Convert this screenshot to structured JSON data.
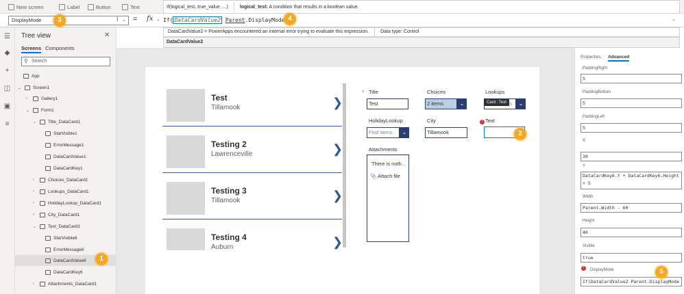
{
  "ribbon": {
    "new_screen": "New screen",
    "label": "Label",
    "button": "Button",
    "text": "Text"
  },
  "tooltip": {
    "signature": "If(logical_test, true_value, ...)",
    "param_name": "logical_test:",
    "param_desc": "A condition that results in a boolean value."
  },
  "formula_bar": {
    "property": "DisplayMode",
    "eq": "=",
    "fx": "fx",
    "formula_prefix": "If(",
    "formula_highlight": "DataCardValue2",
    "formula_rest": "Parent",
    "formula_tail": ".DisplayMode",
    "error_text": "DataCardValue2  =  PowerApps encountered an internal error trying to evaluate this expression.",
    "data_type": "Data type: Control",
    "control_name": "DataCardValue2"
  },
  "tree": {
    "title": "Tree view",
    "tabs": [
      "Screens",
      "Components"
    ],
    "search_placeholder": "Search",
    "nodes": [
      {
        "label": "App"
      },
      {
        "label": "Screen1"
      },
      {
        "label": "Gallery1"
      },
      {
        "label": "Form1"
      },
      {
        "label": "Title_DataCard1"
      },
      {
        "label": "StarVisible1"
      },
      {
        "label": "ErrorMessage1"
      },
      {
        "label": "DataCardValue1"
      },
      {
        "label": "DataCardKey1"
      },
      {
        "label": "Choices_DataCard1"
      },
      {
        "label": "Lookups_DataCard1"
      },
      {
        "label": "HolidayLookup_DataCard1"
      },
      {
        "label": "City_DataCard1"
      },
      {
        "label": "Text_DataCard1"
      },
      {
        "label": "StarVisible6"
      },
      {
        "label": "ErrorMessage6"
      },
      {
        "label": "DataCardValue6"
      },
      {
        "label": "DataCardKey6"
      },
      {
        "label": "Attachments_DataCard1"
      }
    ]
  },
  "gallery": [
    {
      "title": "Test",
      "subtitle": "Tillamook"
    },
    {
      "title": "Testing 2",
      "subtitle": "Lawrenceville"
    },
    {
      "title": "Testing 3",
      "subtitle": "Tillamook"
    },
    {
      "title": "Testing 4",
      "subtitle": "Auburn"
    }
  ],
  "form": {
    "title_label": "Title",
    "title_value": "Test",
    "choices_label": "Choices",
    "choices_value": "2 items",
    "lookups_label": "Lookups",
    "lookups_value": "items",
    "card_tooltip": "Card : Text",
    "holiday_label": "HolidayLookup",
    "holiday_placeholder": "Find items",
    "city_label": "City",
    "city_value": "Tillamook",
    "text_label": "Text",
    "attachments_label": "Attachments",
    "attachments_empty": "There is noth...",
    "attach_file": "Attach file"
  },
  "props": {
    "tabs": [
      "Properties",
      "Advanced"
    ],
    "fields": [
      {
        "label": "PaddingRight",
        "value": "5"
      },
      {
        "label": "PaddingBottom",
        "value": "5"
      },
      {
        "label": "PaddingLeft",
        "value": "5"
      },
      {
        "label": "X",
        "value": "30"
      },
      {
        "label": "Y",
        "value": "DataCardKey6.Y + DataCardKey6.Height + 5"
      },
      {
        "label": "Width",
        "value": "Parent.Width - 60"
      },
      {
        "label": "Height",
        "value": "40"
      },
      {
        "label": "Visible",
        "value": "true"
      },
      {
        "label": "DisplayMode",
        "value": "If(DataCardValue2 Parent.DisplayMode"
      }
    ]
  },
  "badges": [
    "1",
    "2",
    "3",
    "4",
    "5"
  ],
  "colors": {
    "accent": "#0078d4",
    "badge": "#f7a823",
    "error": "#d13438",
    "form_border": "#2b3d6e"
  }
}
